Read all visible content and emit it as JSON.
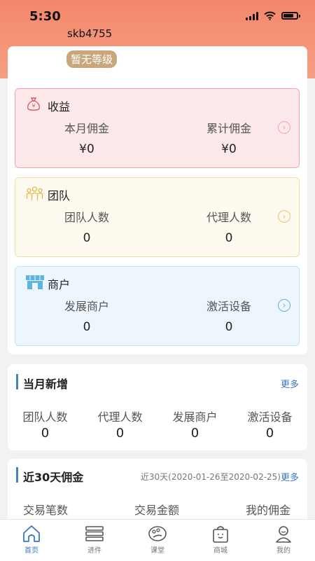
{
  "status": {
    "time": "5:30"
  },
  "user": {
    "name": "skb4755",
    "level": "暂无等级"
  },
  "income": {
    "title": "收益",
    "left_label": "本月佣金",
    "left_value": "¥0",
    "right_label": "累计佣金",
    "right_value": "¥0",
    "color": "#f2a3ab"
  },
  "team": {
    "title": "团队",
    "left_label": "团队人数",
    "left_value": "0",
    "right_label": "代理人数",
    "right_value": "0",
    "color": "#e8c36a"
  },
  "merchant": {
    "title": "商户",
    "left_label": "发展商户",
    "left_value": "0",
    "right_label": "激活设备",
    "right_value": "0",
    "color": "#5fb3e0"
  },
  "monthly": {
    "title": "当月新增",
    "more": "更多",
    "items": [
      {
        "label": "团队人数",
        "value": "0"
      },
      {
        "label": "代理人数",
        "value": "0"
      },
      {
        "label": "发展商户",
        "value": "0"
      },
      {
        "label": "激活设备",
        "value": "0"
      }
    ]
  },
  "last30": {
    "title": "近30天佣金",
    "range": "近30天(2020-01-26至2020-02-25)",
    "more": "更多",
    "columns": [
      "交易笔数",
      "交易金额",
      "我的佣金"
    ]
  },
  "tabs": [
    {
      "label": "首页",
      "icon": "home-icon"
    },
    {
      "label": "进件",
      "icon": "list-icon"
    },
    {
      "label": "课堂",
      "icon": "palette-icon"
    },
    {
      "label": "商城",
      "icon": "shopping-bag-icon"
    },
    {
      "label": "我的",
      "icon": "user-icon"
    }
  ],
  "colors": {
    "accent": "#3b77c5",
    "header": "#f4876b",
    "badge": "#c9a77c"
  }
}
